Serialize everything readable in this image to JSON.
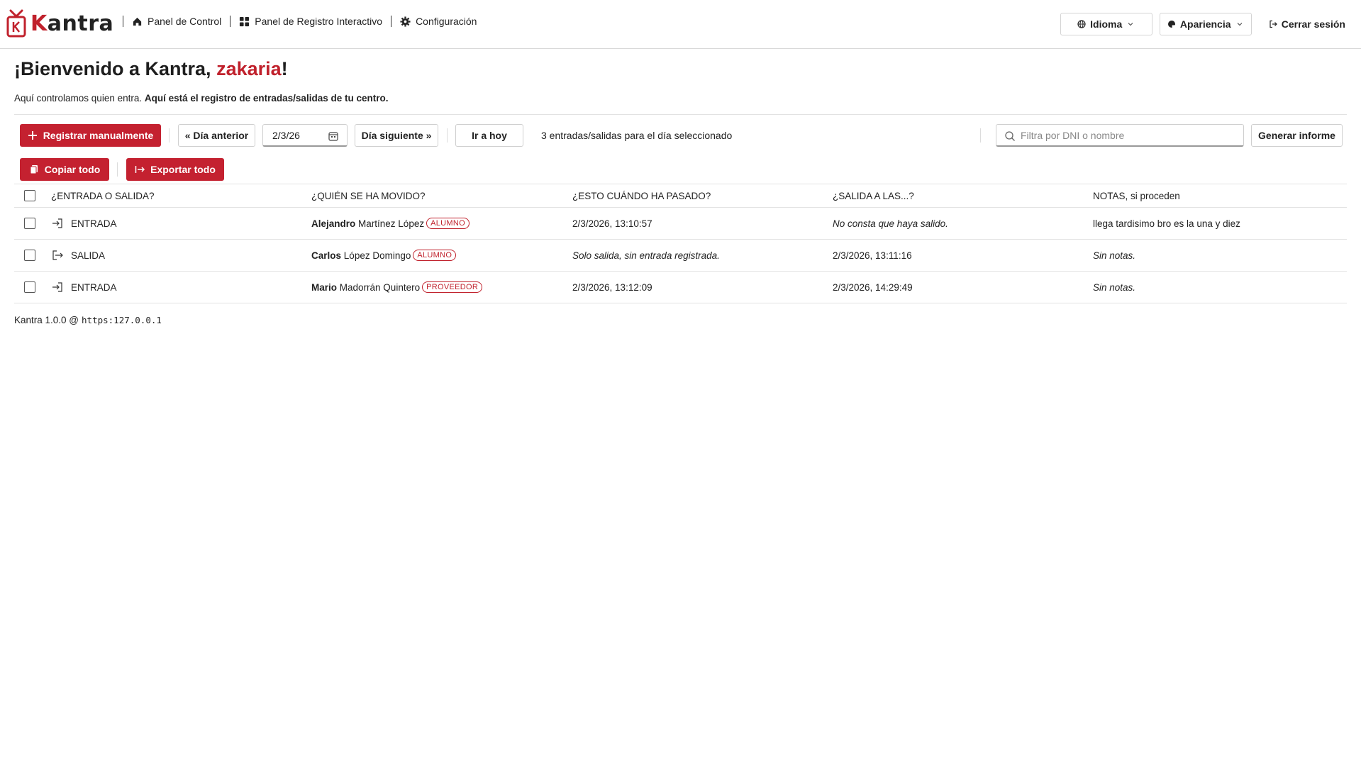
{
  "brand": {
    "name_first": "K",
    "name_rest": "antra"
  },
  "nav": {
    "items": [
      {
        "label": "Panel de Control"
      },
      {
        "label": "Panel de Registro Interactivo"
      },
      {
        "label": "Configuración"
      }
    ]
  },
  "topright": {
    "language_label": "Idioma",
    "appearance_label": "Apariencia",
    "logout_label": "Cerrar sesión"
  },
  "header": {
    "welcome_prefix": "¡Bienvenido a Kantra, ",
    "username": "zakaria",
    "welcome_suffix": "!",
    "subtitle_plain": "Aquí controlamos quien entra. ",
    "subtitle_bold": "Aquí está el registro de entradas/salidas de tu centro."
  },
  "toolbar": {
    "register_label": "Registrar manualmente",
    "prev_day_label": "« Día anterior",
    "date_value": "2/3/26",
    "next_day_label": "Día siguiente »",
    "today_label": "Ir a hoy",
    "count_text": "3 entradas/salidas para el día seleccionado",
    "search_placeholder": "Filtra por DNI o nombre",
    "report_label": "Generar informe",
    "copy_label": "Copiar todo",
    "export_label": "Exportar todo"
  },
  "table": {
    "headers": [
      "¿ENTRADA O SALIDA?",
      "¿QUIÉN SE HA MOVIDO?",
      "¿ESTO CUÁNDO HA PASADO?",
      "¿SALIDA A LAS...?",
      "NOTAS, si proceden"
    ],
    "rows": [
      {
        "direction": "ENTRADA",
        "first": "Alejandro",
        "last": "Martínez López",
        "role": "ALUMNO",
        "when": "2/3/2026, 13:10:57",
        "when_italic": false,
        "exit": "No consta que haya salido.",
        "exit_italic": true,
        "notes": "llega tardisimo bro es la una y diez",
        "notes_italic": false
      },
      {
        "direction": "SALIDA",
        "first": "Carlos",
        "last": "López Domingo",
        "role": "ALUMNO",
        "when": "Solo salida, sin entrada registrada.",
        "when_italic": true,
        "exit": "2/3/2026, 13:11:16",
        "exit_italic": false,
        "notes": "Sin notas.",
        "notes_italic": true
      },
      {
        "direction": "ENTRADA",
        "first": "Mario",
        "last": "Madorrán Quintero",
        "role": "PROVEEDOR",
        "when": "2/3/2026, 13:12:09",
        "when_italic": false,
        "exit": "2/3/2026, 14:29:49",
        "exit_italic": false,
        "notes": "Sin notas.",
        "notes_italic": true
      }
    ]
  },
  "footer": {
    "version": "Kantra 1.0.0 @",
    "host": "https:127.0.0.1"
  },
  "colors": {
    "accent": "#c0212c",
    "border": "#e2e2e2"
  }
}
